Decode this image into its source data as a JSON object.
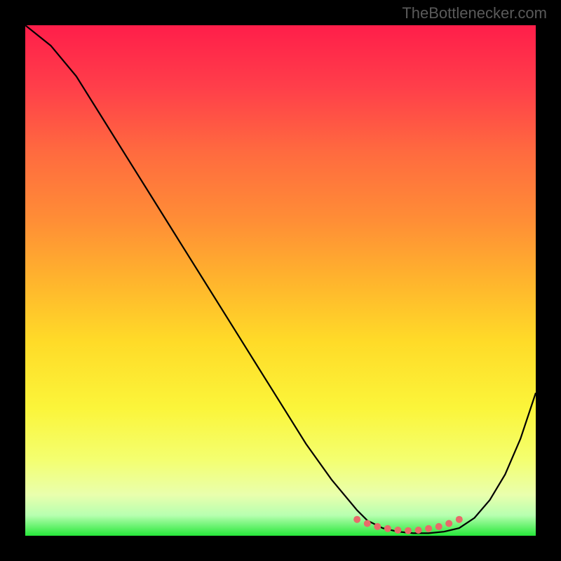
{
  "watermark": "TheBottlenecker.com",
  "chart_data": {
    "type": "line",
    "title": "",
    "xlabel": "",
    "ylabel": "",
    "xlim": [
      0,
      100
    ],
    "ylim": [
      0,
      100
    ],
    "series": [
      {
        "name": "bottleneck-curve",
        "x": [
          0,
          5,
          10,
          15,
          20,
          25,
          30,
          35,
          40,
          45,
          50,
          55,
          60,
          65,
          67,
          70,
          73,
          76,
          79,
          82,
          85,
          88,
          91,
          94,
          97,
          100
        ],
        "y": [
          100,
          96,
          90,
          82,
          74,
          66,
          58,
          50,
          42,
          34,
          26,
          18,
          11,
          5,
          3,
          1.5,
          0.8,
          0.5,
          0.5,
          0.8,
          1.5,
          3.5,
          7,
          12,
          19,
          28
        ]
      }
    ],
    "markers": {
      "name": "optimal-range-dots",
      "x": [
        65,
        67,
        69,
        71,
        73,
        75,
        77,
        79,
        81,
        83,
        85
      ],
      "y": [
        3.2,
        2.4,
        1.8,
        1.4,
        1.1,
        1.0,
        1.1,
        1.4,
        1.8,
        2.4,
        3.2
      ]
    },
    "gradient_colors": {
      "top": "#ff1e4a",
      "mid": "#ffdb28",
      "bottom": "#27e83a"
    }
  }
}
